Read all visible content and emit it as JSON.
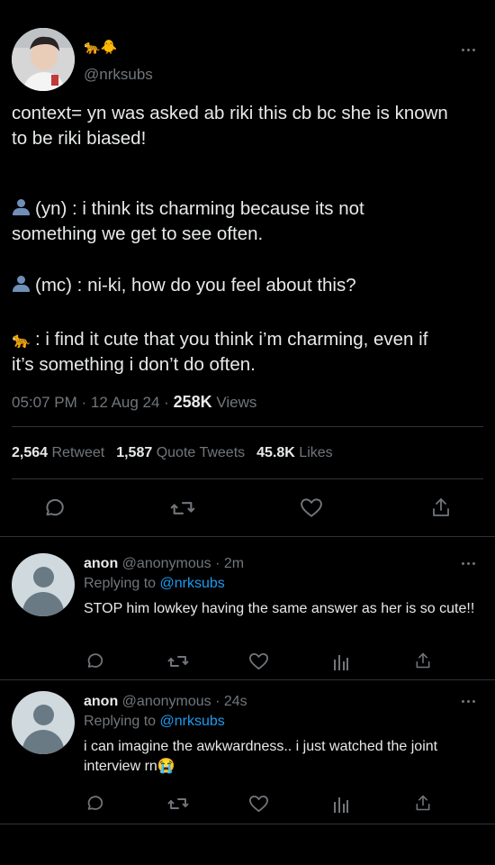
{
  "tweet": {
    "name_emoji": "🐆🐥",
    "handle": "@nrksubs",
    "lines": [
      "context= yn was asked ab riki this cb bc she is known",
      "to be riki biased!",
      "(yn) : i think its charming because its not",
      "something we get to see often.",
      "(mc) : ni-ki, how do you feel about this?",
      ": i find it cute that you think i’m charming, even if",
      "it’s something i don’t do often."
    ],
    "line_icons": {
      "leopard": "🐆"
    },
    "time": "05:07 PM · 12 Aug 24 · ",
    "views_count": "258K",
    "views_label": " Views",
    "stats": {
      "retweets": "2,564",
      "retweets_label": "Retweet",
      "quotes": "1,587",
      "quotes_label": "Quote Tweets",
      "likes": "45.8K",
      "likes_label": "Likes"
    }
  },
  "replies": [
    {
      "name": "anon",
      "handle_time": "@anonymous · 2m",
      "replying_label": "Replying to ",
      "replying_to": "@nrksubs",
      "text": "STOP him lowkey having the same answer as her is so cute!!"
    },
    {
      "name": "anon",
      "handle_time": "@anonymous · 24s",
      "replying_label": "Replying to ",
      "replying_to": "@nrksubs",
      "text": "i can imagine the awkwardness.. i just watched the joint interview rn😭"
    }
  ],
  "colors": {
    "background": "#000000",
    "text": "#e7e9ea",
    "secondary": "#71767b",
    "link": "#1d9bf0",
    "divider": "#2f3336"
  }
}
